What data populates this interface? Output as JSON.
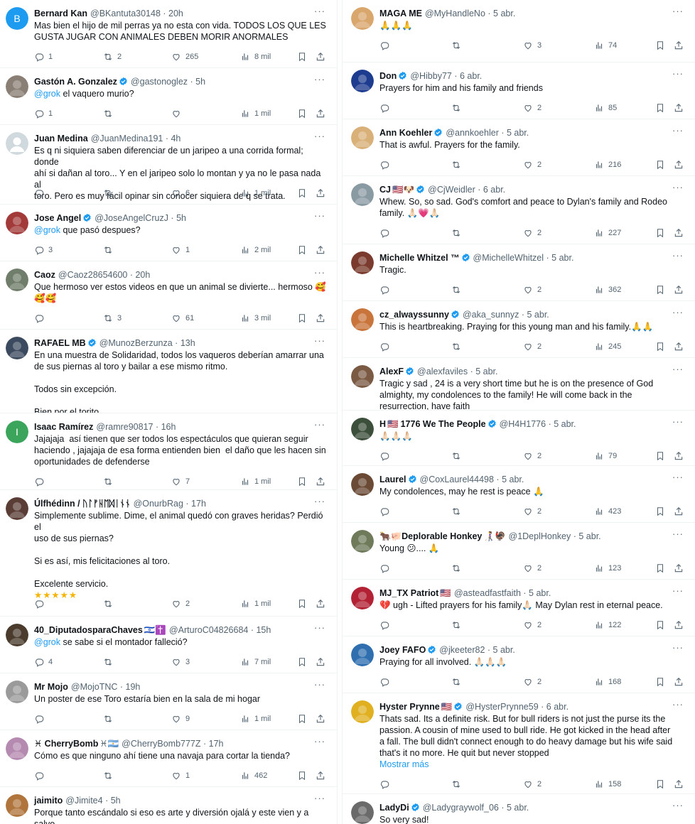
{
  "left_tweets": [
    {
      "name": "Bernard Kan",
      "handle": "@BKantuta30148",
      "time": "20h",
      "verified": false,
      "avatar": {
        "type": "letter",
        "letter": "B",
        "color": "#1d9bf0"
      },
      "lines": [
        "Mas bien el hijo de mil perras ya no esta con vida. TODOS LOS QUE LES",
        "GUSTA JUGAR CON ANIMALES DEBEN MORIR ANORMALES"
      ],
      "replies": "1",
      "reposts": "2",
      "likes": "265",
      "views": "8 mil"
    },
    {
      "name": "Gastón A. Gonzalez",
      "handle": "@gastonoglez",
      "time": "5h",
      "verified": true,
      "avatar": {
        "type": "photo",
        "color": "#8a7f74"
      },
      "mention": "@grok",
      "lines": [
        " el vaquero murio?"
      ],
      "replies": "1",
      "reposts": "",
      "likes": "",
      "views": "1 mil"
    },
    {
      "name": "Juan Medina",
      "handle": "@JuanMedina191",
      "time": "4h",
      "verified": false,
      "avatar": {
        "type": "default",
        "color": "#cfd9de"
      },
      "lines": [
        "Es q ni siquiera saben diferenciar de un jaripeo a una corrida formal; donde",
        "ahí si dañan al toro... Y en el jaripeo solo lo montan y ya no le pasa nada al",
        "toro. Pero es muy fácil opinar sin conocer siquiera de q se trata."
      ],
      "replies": "",
      "reposts": "",
      "likes": "6",
      "views": "1 mil"
    },
    {
      "name": "Jose Angel",
      "handle": "@JoseAngelCruzJ",
      "time": "5h",
      "verified": true,
      "avatar": {
        "type": "photo",
        "color": "#a23a3a"
      },
      "mention": "@grok",
      "lines": [
        " que pasó despues?"
      ],
      "replies": "3",
      "reposts": "",
      "likes": "1",
      "views": "2 mil"
    },
    {
      "name": "Caoz",
      "flag": "cl",
      "handle": "@Caoz28654600",
      "time": "20h",
      "verified": false,
      "avatar": {
        "type": "photo",
        "color": "#6f7d6a"
      },
      "lines": [
        "Que hermoso ver estos videos en que un animal se divierte... hermoso 🥰",
        "🥰🥰"
      ],
      "replies": "",
      "reposts": "3",
      "likes": "61",
      "views": "3 mil"
    },
    {
      "name": "RAFAEL MB",
      "handle": "@MunozBerzunza",
      "time": "13h",
      "verified": true,
      "avatar": {
        "type": "photo",
        "color": "#3b4a5e"
      },
      "lines": [
        "En una muestra de Solidaridad, todos los vaqueros deberían amarrar una",
        "de sus piernas al toro y bailar a ese mismo ritmo.",
        "",
        "Todos sin excepción.",
        "",
        "Bien por el torito"
      ],
      "replies": "",
      "reposts": "",
      "likes": "",
      "views": ""
    },
    {
      "name": "Isaac Ramírez",
      "handle": "@ramre90817",
      "time": "16h",
      "verified": false,
      "avatar": {
        "type": "letter",
        "letter": "I",
        "color": "#3ba55c"
      },
      "lines": [
        "Jajajaja  así tienen que ser todos los espectáculos que quieran seguir",
        "haciendo , jajajaja de esa forma entienden bien  el daño que les hacen sin",
        "oportunidades de defenderse"
      ],
      "replies": "",
      "reposts": "",
      "likes": "7",
      "views": "1 mil"
    },
    {
      "name": "Úlfhédinn / ᚢᛚᚠᚺᛖᛞᛁᚾᚾ",
      "handle": "@OnurbRag",
      "time": "17h",
      "verified": false,
      "avatar": {
        "type": "photo",
        "color": "#5a3e36"
      },
      "lines": [
        "Simplemente sublime. Dime, el animal quedó con graves heridas? Perdió el",
        "uso de sus piernas?",
        "",
        "Si es así, mis felicitaciones al toro.",
        "",
        "Excelente servicio.",
        "★★★★★"
      ],
      "replies": "",
      "reposts": "",
      "likes": "2",
      "views": "1 mil"
    },
    {
      "name": "40_DiputadosparaChaves",
      "suffix": "🇮🇱✝️",
      "handle": "@ArturoC04826684",
      "time": "15h",
      "verified": false,
      "avatar": {
        "type": "photo",
        "color": "#4a3b2c"
      },
      "mention": "@grok",
      "lines": [
        " se sabe si el montador falleció?"
      ],
      "replies": "4",
      "reposts": "",
      "likes": "3",
      "views": "7 mil"
    },
    {
      "name": "Mr Mojo",
      "handle": "@MojoTNC",
      "time": "19h",
      "verified": false,
      "avatar": {
        "type": "photo",
        "color": "#9a9a9a"
      },
      "lines": [
        "Un poster de ese Toro estaría bien en la sala de mi hogar"
      ],
      "replies": "",
      "reposts": "",
      "likes": "9",
      "views": "1 mil"
    },
    {
      "name": "♓ CherryBomb",
      "suffix": "♓🇦🇷",
      "handle": "@CherryBomb777Z",
      "time": "17h",
      "verified": false,
      "avatar": {
        "type": "photo",
        "color": "#b58ab0"
      },
      "lines": [
        "Cómo es que ninguno ahí tiene una navaja para cortar la tienda?"
      ],
      "replies": "",
      "reposts": "",
      "likes": "1",
      "views": "462"
    },
    {
      "name": "jaimito",
      "handle": "@Jimite4",
      "time": "5h",
      "verified": false,
      "avatar": {
        "type": "photo",
        "color": "#b0753c"
      },
      "lines": [
        "Porque tanto escándalo si eso es arte y diversión ojalá y este vien y a salvo"
      ],
      "replies": "",
      "reposts": "",
      "likes": "",
      "views": ""
    }
  ],
  "right_tweets": [
    {
      "name": "MAGA ME",
      "handle": "@MyHandleNo",
      "time": "5 abr.",
      "verified": false,
      "avatar": {
        "type": "photo",
        "color": "#d9a66c"
      },
      "lines": [
        "🙏🙏🙏"
      ],
      "replies": "",
      "reposts": "",
      "likes": "3",
      "views": "74"
    },
    {
      "name": "Don",
      "handle": "@Hibby77",
      "time": "6 abr.",
      "verified": true,
      "avatar": {
        "type": "photo",
        "color": "#1d3c8f"
      },
      "lines": [
        "Prayers for him and his family and friends"
      ],
      "replies": "",
      "reposts": "",
      "likes": "2",
      "views": "85"
    },
    {
      "name": "Ann Koehler",
      "handle": "@annkoehler",
      "time": "5 abr.",
      "verified": true,
      "avatar": {
        "type": "photo",
        "color": "#d8b078"
      },
      "lines": [
        "That is awful. Prayers for the family."
      ],
      "replies": "",
      "reposts": "",
      "likes": "2",
      "views": "216"
    },
    {
      "name": "CJ",
      "suffix": "🇺🇸🐶",
      "handle": "@CjWeidler",
      "time": "6 abr.",
      "verified": true,
      "avatar": {
        "type": "photo",
        "color": "#8a9aa3"
      },
      "lines": [
        "Whew. So, so sad. God's comfort and peace to Dylan's family and Rodeo",
        "family. 🙏🏻💗🙏🏻"
      ],
      "replies": "",
      "reposts": "",
      "likes": "2",
      "views": "227"
    },
    {
      "name": "Michelle Whitzel ™",
      "handle": "@MichelleWhitzel",
      "time": "5 abr.",
      "verified": true,
      "avatar": {
        "type": "photo",
        "color": "#7a3b2e"
      },
      "lines": [
        "Tragic."
      ],
      "replies": "",
      "reposts": "",
      "likes": "2",
      "views": "362"
    },
    {
      "name": "cz_alwayssunny",
      "handle": "@aka_sunnyz",
      "time": "5 abr.",
      "verified": true,
      "avatar": {
        "type": "photo",
        "color": "#c9743a"
      },
      "lines": [
        "This is heartbreaking. Praying for this young man and his family.🙏🙏"
      ],
      "replies": "",
      "reposts": "",
      "likes": "2",
      "views": "245"
    },
    {
      "name": "AlexF",
      "handle": "@alexfaviles",
      "time": "5 abr.",
      "verified": true,
      "avatar": {
        "type": "photo",
        "color": "#7b5a44"
      },
      "lines": [
        "Tragic y sad , 24 is a very short time but he is on the presence of God",
        "almighty, my condolences to the family! He will come back in the",
        "resurrection, have faith"
      ],
      "replies": "",
      "reposts": "",
      "likes": "",
      "views": ""
    },
    {
      "name": "H",
      "suffix": "🇺🇸",
      "name2": "1776 We The People",
      "handle": "@H4H1776",
      "time": "5 abr.",
      "verified": true,
      "avatar": {
        "type": "photo",
        "color": "#3b4f3a"
      },
      "lines": [
        "🙏🏻🙏🏻🙏🏻"
      ],
      "replies": "",
      "reposts": "",
      "likes": "2",
      "views": "79"
    },
    {
      "name": "Laurel",
      "handle": "@CoxLaurel44498",
      "time": "5 abr.",
      "verified": true,
      "avatar": {
        "type": "photo",
        "color": "#6b4a35"
      },
      "lines": [
        "My condolences, may he rest is peace 🙏"
      ],
      "replies": "",
      "reposts": "",
      "likes": "2",
      "views": "423"
    },
    {
      "name": "Deplorable Honkey",
      "prefix": "🐂🐖",
      "suffix": "👩‍🦯🦃",
      "handle": "@1DeplHonkey",
      "time": "5 abr.",
      "verified": false,
      "avatar": {
        "type": "photo",
        "color": "#6e7a5a"
      },
      "lines": [
        "Young 😕.... 🙏"
      ],
      "replies": "",
      "reposts": "",
      "likes": "2",
      "views": "123"
    },
    {
      "name": "MJ_TX Patriot",
      "suffix": "🇺🇸",
      "handle": "@asteadfastfaith",
      "time": "5 abr.",
      "verified": false,
      "avatar": {
        "type": "photo",
        "color": "#b22234"
      },
      "lines": [
        "💔 ugh - Lifted prayers for his family🙏🏻 May Dylan rest in eternal peace."
      ],
      "replies": "",
      "reposts": "",
      "likes": "2",
      "views": "122"
    },
    {
      "name": "Joey FAFO",
      "handle": "@jkeeter82",
      "time": "5 abr.",
      "verified": true,
      "avatar": {
        "type": "photo",
        "color": "#2f6fb0"
      },
      "lines": [
        "Praying for all involved. 🙏🏻🙏🏻🙏🏻"
      ],
      "replies": "",
      "reposts": "",
      "likes": "2",
      "views": "168"
    },
    {
      "name": "Hyster Prynne",
      "suffix": "🇺🇸",
      "handle": "@HysterPrynne59",
      "time": "6 abr.",
      "verified": true,
      "avatar": {
        "type": "photo",
        "color": "#e0b020"
      },
      "lines": [
        "Thats sad. Its a definite risk. But for bull riders is not just the purse its the",
        "passion. A cousin of mine used to bull ride. He got kicked in the head after",
        "a fall. The bull didn't connect enough to do heavy damage but his wife said",
        "that's it no more. He quit but never stopped"
      ],
      "showmore": "Mostrar más",
      "replies": "",
      "reposts": "",
      "likes": "2",
      "views": "158"
    },
    {
      "name": "LadyDi",
      "handle": "@Ladygraywolf_06",
      "time": "5 abr.",
      "verified": true,
      "avatar": {
        "type": "photo",
        "color": "#6a6a6a"
      },
      "lines": [
        "So very sad!"
      ],
      "replies": "",
      "reposts": "",
      "likes": "",
      "views": ""
    }
  ],
  "colors": {
    "accent": "#1d9bf0",
    "text": "#0f1419",
    "muted": "#536471",
    "border": "#eff3f4"
  },
  "icons": [
    "reply-icon",
    "repost-icon",
    "like-icon",
    "views-icon",
    "bookmark-icon",
    "share-icon",
    "more-icon",
    "verified-badge-icon"
  ]
}
